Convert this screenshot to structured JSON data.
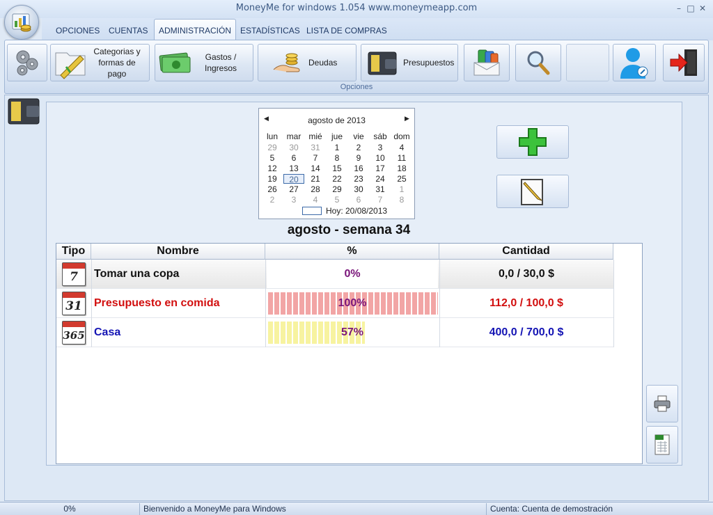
{
  "window": {
    "title": "MoneyMe for windows 1.054 www.moneymeapp.com",
    "controls": [
      "–",
      "□",
      "✕"
    ]
  },
  "tabs": [
    {
      "label": "OPCIONES",
      "active": false
    },
    {
      "label": "CUENTAS",
      "active": false
    },
    {
      "label": "ADMINISTRACIÓN",
      "active": true
    },
    {
      "label": "ESTADÍSTICAS",
      "active": false
    },
    {
      "label": "LISTA DE COMPRAS",
      "active": false
    }
  ],
  "ribbon": {
    "group_label": "Opciones",
    "buttons": {
      "settings": {
        "icon": "gears-icon"
      },
      "categories": {
        "label_lines": [
          "Categorias y",
          "formas de",
          "pago"
        ],
        "icon": "folder-pencil-icon"
      },
      "transactions": {
        "label_lines": [
          "Gastos /",
          "Ingresos"
        ],
        "icon": "money-icon"
      },
      "debts": {
        "label": "Deudas",
        "icon": "hand-coins-icon"
      },
      "budgets": {
        "label": "Presupuestos",
        "icon": "wallet-icon"
      },
      "cards": {
        "icon": "cards-envelope-icon"
      },
      "search": {
        "icon": "magnifier-icon"
      },
      "user": {
        "icon": "user-icon"
      },
      "exit": {
        "icon": "exit-icon"
      }
    }
  },
  "calendar": {
    "month_label": "agosto de 2013",
    "day_names": [
      "lun",
      "mar",
      "mié",
      "jue",
      "vie",
      "sáb",
      "dom"
    ],
    "weeks": [
      [
        "29",
        "30",
        "31",
        "1",
        "2",
        "3",
        "4"
      ],
      [
        "5",
        "6",
        "7",
        "8",
        "9",
        "10",
        "11"
      ],
      [
        "12",
        "13",
        "14",
        "15",
        "16",
        "17",
        "18"
      ],
      [
        "19",
        "20",
        "21",
        "22",
        "23",
        "24",
        "25"
      ],
      [
        "26",
        "27",
        "28",
        "29",
        "30",
        "31",
        "1"
      ],
      [
        "2",
        "3",
        "4",
        "5",
        "6",
        "7",
        "8"
      ]
    ],
    "selected_day": "20",
    "today_label": "Hoy: 20/08/2013"
  },
  "actions": {
    "add_icon": "plus-icon",
    "edit_icon": "edit-note-icon"
  },
  "week_title": "agosto - semana 34",
  "table": {
    "headers": [
      "Tipo",
      "Nombre",
      "%",
      "Cantidad"
    ],
    "rows": [
      {
        "type_icon": "7",
        "name": "Tomar una copa",
        "percent": "0%",
        "amount": "0,0 / 30,0 $",
        "progress": 0,
        "name_color": "#111111",
        "amount_color": "#111111",
        "bar_color": "none"
      },
      {
        "type_icon": "31",
        "name": "Presupuesto en comida",
        "percent": "100%",
        "amount": "112,0 / 100,0 $",
        "progress": 1.0,
        "name_color": "#d20f0f",
        "amount_color": "#d20f0f",
        "bar_color": "#f2a5a5"
      },
      {
        "type_icon": "365",
        "name": "Casa",
        "percent": "57%",
        "amount": "400,0 / 700,0 $",
        "progress": 0.57,
        "name_color": "#1414b4",
        "amount_color": "#1414b4",
        "bar_color": "#f7f3a0"
      }
    ],
    "percent_color": "#7a157a"
  },
  "side_buttons": {
    "print_icon": "printer-icon",
    "export_icon": "excel-export-icon"
  },
  "status": {
    "progress": "0%",
    "message": "Bienvenido a MoneyMe para Windows",
    "account": "Cuenta: Cuenta de demostración"
  }
}
